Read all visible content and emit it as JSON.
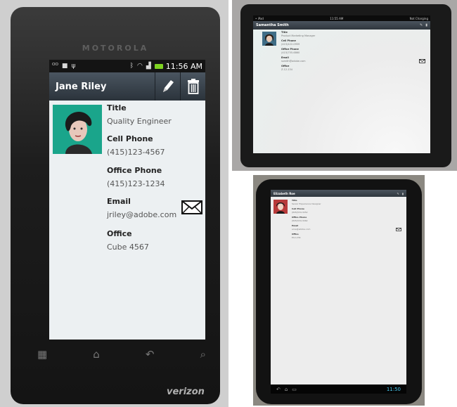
{
  "phone": {
    "brand": "MOTOROLA",
    "carrier": "verizon",
    "status_time": "11:56 AM",
    "contact_name": "Jane Riley",
    "fields": [
      {
        "label": "Title",
        "value": "Quality Engineer"
      },
      {
        "label": "Cell Phone",
        "value": "(415)123-4567"
      },
      {
        "label": "Office Phone",
        "value": "(415)123-1234"
      },
      {
        "label": "Email",
        "value": "jriley@adobe.com"
      },
      {
        "label": "Office",
        "value": "Cube 4567"
      }
    ],
    "icons": [
      "voicemail-icon",
      "usb-icon",
      "bluetooth-icon",
      "wifi-icon",
      "signal-icon",
      "battery-icon",
      "edit-pencil-icon",
      "trash-icon",
      "email-envelope-icon",
      "grid-menu-icon",
      "home-icon",
      "back-icon",
      "search-icon"
    ]
  },
  "ipad": {
    "status_left": "• iPad",
    "status_center": "11:55 AM",
    "status_right": "Not Charging",
    "contact_name": "Samantha Smith",
    "fields": [
      {
        "label": "Title",
        "value": "Product Marketing Manager"
      },
      {
        "label": "Cell Phone",
        "value": "(415)422-0959"
      },
      {
        "label": "Office Phone",
        "value": "(415)755-6860"
      },
      {
        "label": "Email",
        "value": "ssmith@adobe.com"
      },
      {
        "label": "Office",
        "value": "Z-12-134"
      }
    ]
  },
  "xoom": {
    "contact_name": "Elizabeth Roe",
    "status_time": "11:50",
    "fields": [
      {
        "label": "Title",
        "value": "Senior Experience Designer"
      },
      {
        "label": "Cell Phone",
        "value": "(845)534-3452"
      },
      {
        "label": "Office Phone",
        "value": "(845)534-3462"
      },
      {
        "label": "Email",
        "value": "eroe@adobe.com"
      },
      {
        "label": "Office",
        "value": "E12-234"
      }
    ]
  },
  "colors": {
    "teal_avatar": "#1aa58b",
    "action_bar": "#3a434c",
    "xoom_clock": "#48c9ef"
  }
}
